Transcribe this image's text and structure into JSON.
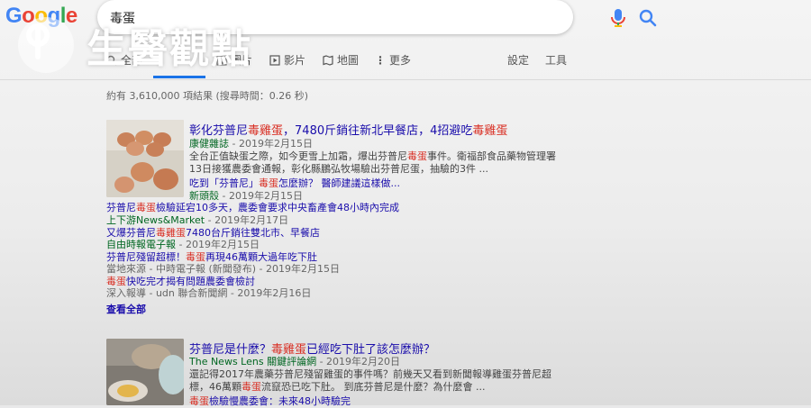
{
  "search": {
    "query": "毒蛋"
  },
  "logo": {
    "text": "Google"
  },
  "watermark": {
    "text": "生醫觀點"
  },
  "tabs": [
    {
      "label": "全部",
      "icon": "search-icon"
    },
    {
      "label": "圖片",
      "icon": "image-icon"
    },
    {
      "label": "影片",
      "icon": "play-icon"
    },
    {
      "label": "地圖",
      "icon": "map-icon"
    },
    {
      "label": "更多",
      "icon": "more-vert-icon"
    },
    {
      "label": "設定"
    },
    {
      "label": "工具"
    }
  ],
  "stats": "約有 3,610,000 項結果 (搜尋時間：0.26 秒)",
  "result1": {
    "title_pre": "彰化芬普尼",
    "title_hl1": "毒雞蛋",
    "title_mid": "，7480斤銷往新北早餐店，4招避吃",
    "title_hl2": "毒雞蛋",
    "source": "康健雜誌",
    "date": " - 2019年2月15日",
    "snippet1_pre": "全台正值缺蛋之際，如今更雪上加霜，爆出芬普尼",
    "snippet1_hl": "毒蛋",
    "snippet1_post": "事件。衛福部食品藥物管理署",
    "snippet2": "13日接獲農委會通報，彰化縣鵬弘牧場驗出芬普尼蛋，抽驗的3件 ...",
    "sub": [
      {
        "pre": "吃到「芬普尼」",
        "hl": "毒蛋",
        "post": "怎麼辦？ 醫師建議這樣做...",
        "source": "新頭殼",
        "date": " - 2019年2月15日"
      },
      {
        "pre": "芬普尼",
        "hl": "毒蛋",
        "post": "檢驗延宕10多天，農委會要求中央畜產會48小時內完成",
        "source": "上下游News&Market",
        "date": " - 2019年2月17日"
      },
      {
        "pre": "又爆芬普尼",
        "hl": "毒雞蛋",
        "post": "7480台斤銷往雙北市、早餐店",
        "source": "自由時報電子報",
        "date": " - 2019年2月15日"
      },
      {
        "pre": "芬普尼殘留超標！",
        "hl": "毒蛋",
        "post": "再現46萬顆大過年吃下肚",
        "source": "當地來源",
        "date": " - 中時電子報 (新聞發布) - 2019年2月15日"
      },
      {
        "pre": "",
        "hl": "毒蛋",
        "post": "快吃完才揭有問題農委會檢討",
        "source": "深入報導",
        "date": " - udn 聯合新聞網 - 2019年2月16日"
      }
    ],
    "see_all": "查看全部"
  },
  "result2": {
    "title_pre": "芬普尼是什麼？",
    "title_hl": "毒雞蛋",
    "title_post": "已經吃下肚了該怎麼辦？",
    "source": "The News Lens 關鍵評論網",
    "date": " - 2019年2月20日",
    "snippet1": "還記得2017年農藥芬普尼殘留雞蛋的事件嗎？前幾天又看到新聞報導雞蛋芬普尼超",
    "snippet2_pre": "標，46萬顆",
    "snippet2_hl": "毒蛋",
    "snippet2_post": "流竄恐已吃下肚。 到底芬普尼是什麼？為什麼會 ...",
    "sub_pre": "",
    "sub_hl": "毒蛋",
    "sub_post": "檢驗慢農委會：未來48小時驗完"
  },
  "colors": {
    "link": "#1a0dab",
    "highlight": "#d93025",
    "url_green": "#006621",
    "accent": "#1a73e8"
  }
}
